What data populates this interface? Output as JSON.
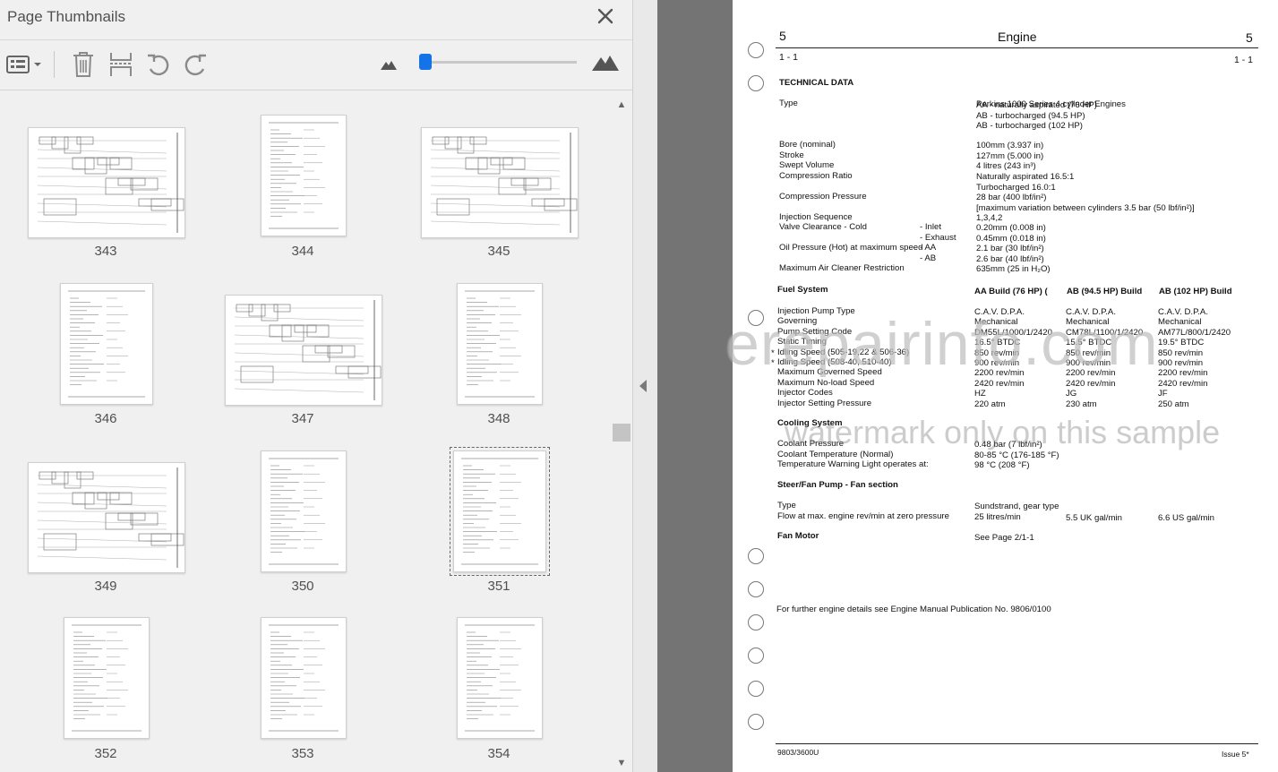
{
  "panel": {
    "title": "Page Thumbnails"
  },
  "toolbar": {
    "options_icon": "list-options-icon",
    "delete_icon": "trash-icon",
    "extract_icon": "extract-pages-icon",
    "undo_icon": "rotate-ccw-icon",
    "redo_icon": "rotate-cw-icon",
    "zoom_small_icon": "mountain-small-icon",
    "zoom_large_icon": "mountain-large-icon",
    "zoom_level": 0.03
  },
  "thumbnails": [
    {
      "page": "343"
    },
    {
      "page": "344"
    },
    {
      "page": "345"
    },
    {
      "page": "346"
    },
    {
      "page": "347"
    },
    {
      "page": "348"
    },
    {
      "page": "349"
    },
    {
      "page": "350"
    },
    {
      "page": "351"
    },
    {
      "page": "352"
    },
    {
      "page": "353"
    },
    {
      "page": "354"
    }
  ],
  "selected_page": "351",
  "document": {
    "section_left": "5",
    "section_title": "Engine",
    "section_right": "5",
    "page_left": "1 - 1",
    "page_right": "1 - 1",
    "technical_data": "TECHNICAL DATA",
    "rows": [
      {
        "label": "Type",
        "value": "Perkins 1000 Series 4 cylinder Engines"
      },
      {
        "label": "",
        "value": "AA - naturally aspirated (76 HP)"
      },
      {
        "label": "",
        "value": "AB - turbocharged (94.5 HP)"
      },
      {
        "label": "",
        "value": "AB - turbocharged (102 HP)"
      },
      {
        "label": "Bore (nominal)",
        "value": "100mm (3.937 in)"
      },
      {
        "label": "Stroke",
        "value": "127mm (5.000 in)"
      },
      {
        "label": "Swept Volume",
        "value": "4 litres (243 in³)"
      },
      {
        "label": "Compression Ratio",
        "value": "Naturally aspirated 16.5:1"
      },
      {
        "label": "",
        "value": "Turbocharged 16.0:1"
      },
      {
        "label": "Compression Pressure",
        "value": "28 bar (400 lbf/in²)"
      },
      {
        "label": "",
        "value": "[maximum variation between cylinders 3.5 bar (50 lbf/in²)]"
      },
      {
        "label": "Injection Sequence",
        "value": "1,3,4,2"
      },
      {
        "label": "Valve Clearance - Cold",
        "sub": "- Inlet",
        "value": "0.20mm (0.008 in)"
      },
      {
        "label": "",
        "sub": "- Exhaust",
        "value": "0.45mm (0.018 in)"
      },
      {
        "label": "Oil Pressure (Hot) at maximum speed",
        "sub": "- AA",
        "value": "2.1 bar (30 lbf/in²)"
      },
      {
        "label": "",
        "sub": "- AB",
        "value": "2.6 bar (40 lbf/in²)"
      },
      {
        "label": "Maximum Air Cleaner Restriction",
        "value": "635mm (25 in H₂O)"
      }
    ],
    "fuel": {
      "heading": "Fuel System",
      "cols": [
        "AA Build (76 HP) (",
        "AB (94.5 HP) Build",
        "AB (102 HP)  Build"
      ],
      "rows": [
        {
          "label": "Injection Pump Type",
          "v": [
            "C.A.V. D.P.A.",
            "C.A.V. D.P.A.",
            "C.A.V. D.P.A."
          ]
        },
        {
          "label": "Governing",
          "v": [
            "Mechanical",
            "Mechanical",
            "Mechanical"
          ]
        },
        {
          "label": "Pump Setting Code",
          "v": [
            "DM55L/1000/1/2420",
            "CM78L/1100/1/2420",
            "AM77L/800/1/2420"
          ]
        },
        {
          "label": "Static Timing",
          "v": [
            "16.5° BTDC",
            "15.5° BTDC",
            "19.5° BTDC"
          ]
        },
        {
          "label": "Idling Speed (505-19,22 & 506-36)",
          "v": [
            "850 rev/min",
            "850 rev/min",
            "850 rev/min"
          ]
        },
        {
          "label": "Idling Speed (508-40, 510-40)",
          "v": [
            "900 rev/min",
            "900 rev/min",
            "900 rev/min"
          ]
        },
        {
          "label": "Maximum Governed Speed",
          "v": [
            "2200 rev/min",
            "2200 rev/min",
            "2200 rev/min"
          ]
        },
        {
          "label": "Maximum No-load Speed",
          "v": [
            "2420 rev/min",
            "2420 rev/min",
            "2420 rev/min"
          ]
        },
        {
          "label": "Injector Codes",
          "v": [
            "HZ",
            "JG",
            "JF"
          ]
        },
        {
          "label": "Injector Setting Pressure",
          "v": [
            "220 atm",
            "230 atm",
            "250 atm"
          ]
        }
      ]
    },
    "cooling": {
      "heading": "Cooling System",
      "rows": [
        {
          "label": "Coolant Pressure",
          "value": "0.48 bar (7 lbf/in²)"
        },
        {
          "label": "Coolant Temperature (Normal)",
          "value": "80-85 °C (176-185 °F)"
        },
        {
          "label": "Temperature Warning Light operates at:",
          "value": "98 °C (208 °F)"
        }
      ]
    },
    "steer": {
      "heading": "Steer/Fan Pump - Fan section",
      "type_label": "Type",
      "type_value": "Sundstrand, gear type",
      "flow_label": "Flow at max.  engine rev/min at zero pressure",
      "flow_values": [
        "25 litres/min",
        "5.5 UK gal/min",
        "6.6 US gal/min"
      ]
    },
    "fan": {
      "heading": "Fan Motor",
      "value": "See Page 2/1-1"
    },
    "further": "For further engine details see Engine Manual Publication No. 9806/0100",
    "footer_left": "9803/3600U",
    "footer_right": "Issue 5*",
    "asterisk": "*"
  },
  "watermark": {
    "line1": "erepairinfo.com",
    "line2": "watermark only on this sample"
  }
}
